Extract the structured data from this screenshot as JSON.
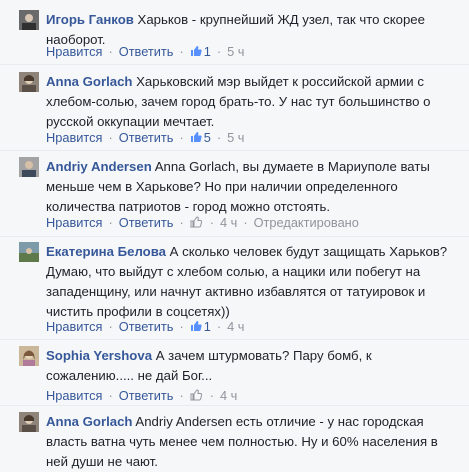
{
  "comments": [
    {
      "author": "Игорь Ганков",
      "text": "Харьков - крупнейший ЖД узел, так что скорее наоборот.",
      "like_label": "Нравится",
      "reply_label": "Ответить",
      "likes": "1",
      "time": "5 ч",
      "edited": ""
    },
    {
      "author": "Anna Gorlach",
      "text": "Харьковский мэр выйдет к российской армии с хлебом-солью, зачем город брать-то. У нас тут большинство о русской оккупации мечтает.",
      "like_label": "Нравится",
      "reply_label": "Ответить",
      "likes": "5",
      "time": "5 ч",
      "edited": ""
    },
    {
      "author": "Andriy Andersen",
      "text": "Anna Gorlach, вы думаете в Мариуполе ваты меньше чем в Харькове? Но при наличии определенного количества патриотов - город можно отстоять.",
      "like_label": "Нравится",
      "reply_label": "Ответить",
      "likes": "",
      "time": "4 ч",
      "edited": "Отредактировано"
    },
    {
      "author": "Екатерина Белова",
      "text": "А сколько человек будут защищать Харьков? Думаю, что выйдут с хлебом солью, а нацики или побегут на западенщину, или начнут активно избавлятся от татуировок и чистить профили в соцсетях))",
      "like_label": "Нравится",
      "reply_label": "Ответить",
      "likes": "1",
      "time": "4 ч",
      "edited": ""
    },
    {
      "author": "Sophia Yershova",
      "text": "А зачем штурмовать? Пару бомб, к сожалению..... не дай Бог...",
      "like_label": "Нравится",
      "reply_label": "Ответить",
      "likes": "",
      "time": "4 ч",
      "edited": ""
    },
    {
      "author": "Anna Gorlach",
      "text": "Andriy Andersen есть отличие - у нас городская власть ватна чуть менее чем полностью. Ну и 60% населения в ней души не чают.",
      "like_label": "",
      "reply_label": "",
      "likes": "",
      "time": "",
      "edited": ""
    }
  ],
  "icons": {
    "like": "thumbs-up-icon"
  },
  "colors": {
    "link": "#365899",
    "meta": "#90949c",
    "background": "#f6f7f9",
    "separator": "#e9ebee"
  }
}
